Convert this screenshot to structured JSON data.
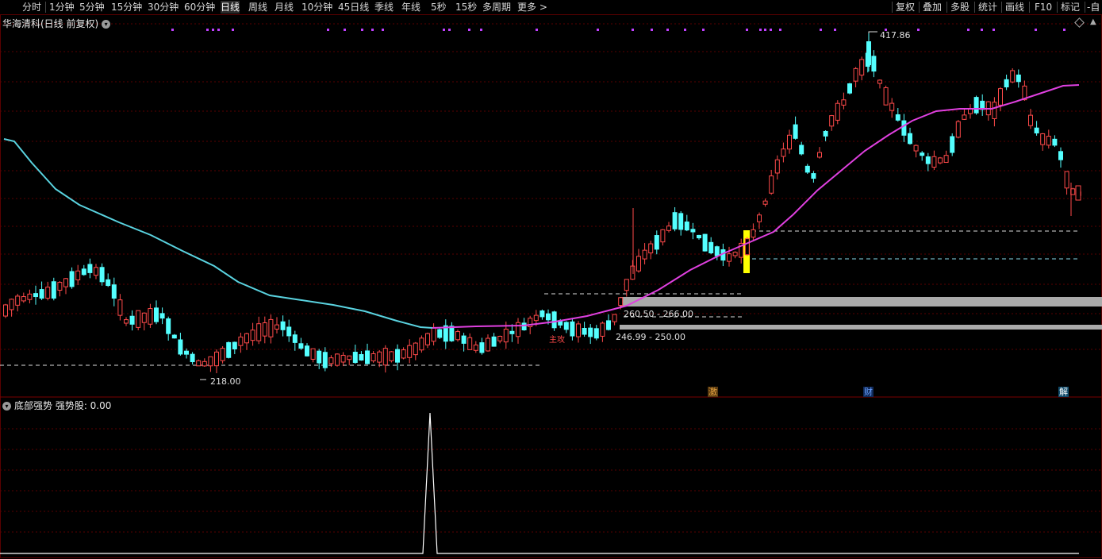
{
  "toolbar": {
    "items": [
      "分时",
      "1分钟",
      "5分钟",
      "15分钟",
      "30分钟",
      "60分钟",
      "日线",
      "周线",
      "月线",
      "10分钟",
      "45日线",
      "季线",
      "年线",
      "5秒",
      "15秒",
      "多周期",
      "更多 >"
    ],
    "right_items": [
      "复权",
      "叠加",
      "多股",
      "统计",
      "画线",
      "F10",
      "标记",
      "-自"
    ],
    "active_index": 6
  },
  "main_chart": {
    "title": "华海清科(日线 前复权)",
    "high_label": "417.86",
    "low_label": "218.00",
    "zone_label_1": "260.50 - 266.00",
    "zone_label_2": "246.99 - 250.00",
    "signal_text": "主攻"
  },
  "badges": [
    {
      "text": "激",
      "color": "#e0a040"
    },
    {
      "text": "财",
      "color": "#6aa0ff"
    },
    {
      "text": "解",
      "color": "#ffffff"
    }
  ],
  "sub_chart": {
    "title": "底部强势  强势股: 0.00"
  },
  "colors": {
    "up": "#ff4a4a",
    "down": "#54ffff",
    "ma_cyan": "#5ad3e0",
    "ma_magenta": "#e040e0",
    "grid": "#5a0000",
    "marker_purple": "#c040ff",
    "highlight_yellow": "#ffff00"
  }
}
